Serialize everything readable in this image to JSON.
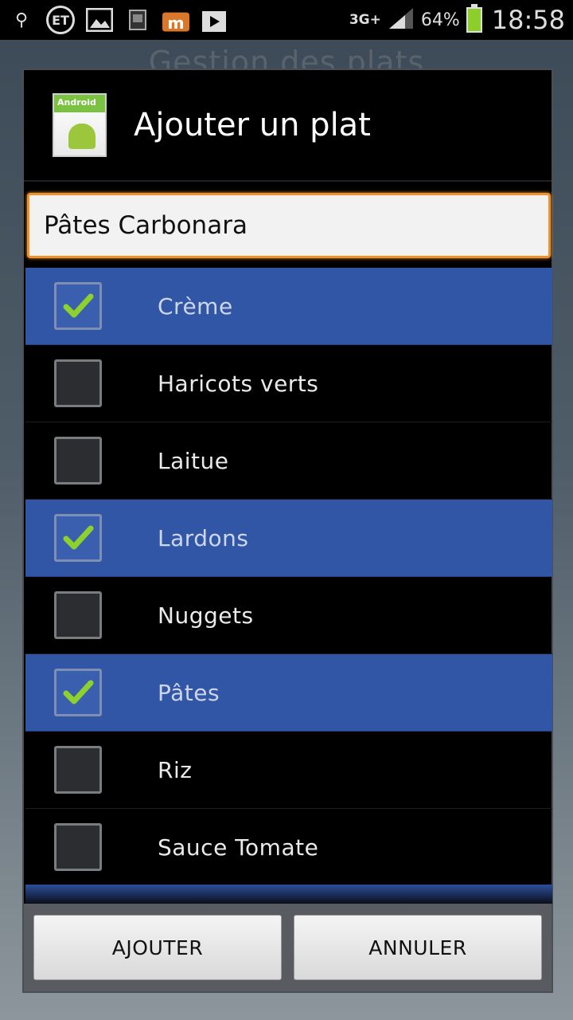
{
  "status_bar": {
    "icons": [
      "usb-icon",
      "et-icon",
      "image-icon",
      "sim-icon",
      "m-app-icon",
      "play-store-icon"
    ],
    "et_label": "ET",
    "network": "3G+",
    "battery_percent": "64%",
    "time": "18:58"
  },
  "background": {
    "title": "Gestion des plats"
  },
  "dialog": {
    "title": "Ajouter un plat",
    "app_icon_label": "Android",
    "name_input_value": "Pâtes Carbonara",
    "items": [
      {
        "label": "Crème",
        "checked": true
      },
      {
        "label": "Haricots verts",
        "checked": false
      },
      {
        "label": "Laitue",
        "checked": false
      },
      {
        "label": "Lardons",
        "checked": true
      },
      {
        "label": "Nuggets",
        "checked": false
      },
      {
        "label": "Pâtes",
        "checked": true
      },
      {
        "label": "Riz",
        "checked": false
      },
      {
        "label": "Sauce Tomate",
        "checked": false
      }
    ],
    "buttons": {
      "add": "AJOUTER",
      "cancel": "ANNULER"
    }
  },
  "colors": {
    "selected_row": "#3256a6",
    "input_focus": "#f0922c",
    "check_mark": "#8fd12c"
  }
}
